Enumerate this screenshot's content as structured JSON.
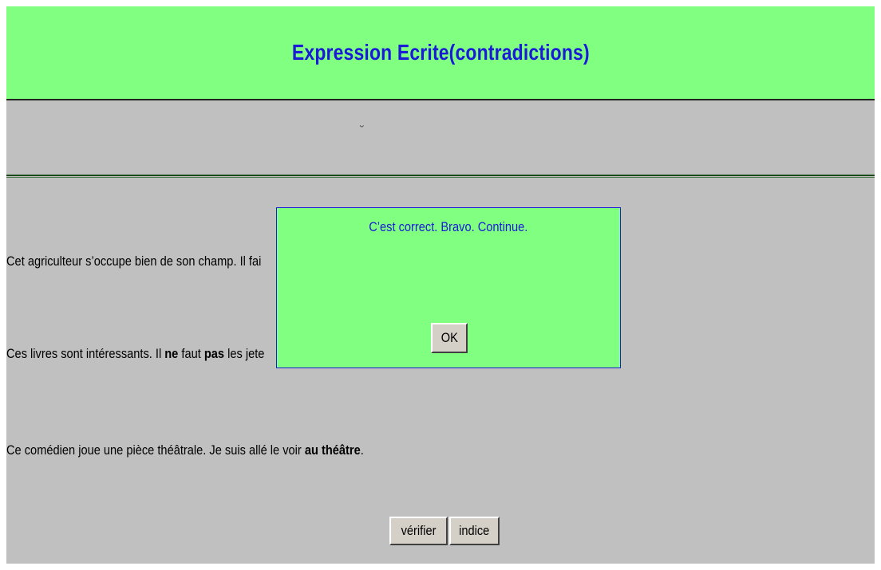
{
  "header": {
    "title": "Expression Ecrite(contradictions)",
    "background": "#80ff80",
    "title_color": "#1a1ad8"
  },
  "subbar": {
    "accent_glyph": "˘"
  },
  "sentences": [
    {
      "pre": "Cet agriculteur s’occupe bien de son champ. Il fai",
      "bold1": "",
      "mid": "",
      "bold2": "",
      "post": ""
    },
    {
      "pre": "Ces livres sont intéressants. Il ",
      "bold1": "ne",
      "mid": " faut ",
      "bold2": "pas",
      "post": " les jete"
    },
    {
      "pre": "Ce comédien joue une pièce théâtrale. Je suis allé le voir ",
      "bold1": "au théâtre",
      "mid": ".",
      "bold2": "",
      "post": ""
    }
  ],
  "buttons": {
    "verify_label": "vérifier",
    "hint_label": "indice"
  },
  "dialog": {
    "message": "C’est correct. Bravo. Continue.",
    "ok_label": "OK",
    "background": "#80ff80",
    "border_color": "#1a1ad8"
  },
  "colors": {
    "page_background": "#c0c0c0",
    "button_face": "#d4d0c8"
  }
}
